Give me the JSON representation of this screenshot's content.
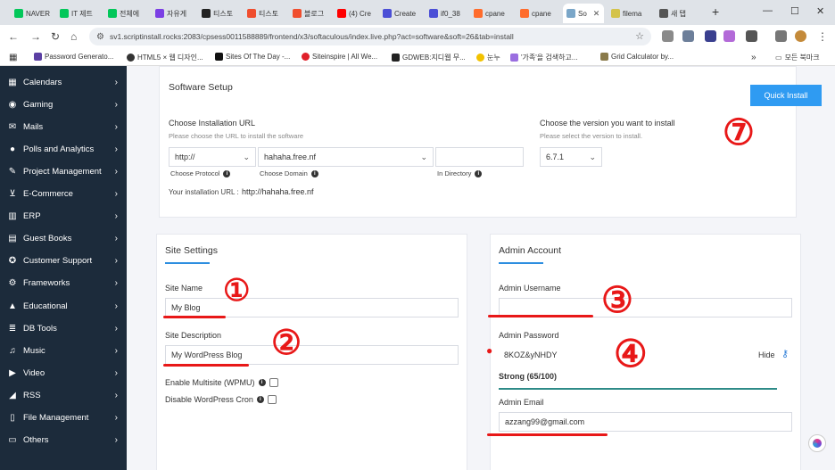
{
  "browser": {
    "tabs": [
      {
        "label": "NAVER",
        "color": "#03c75a"
      },
      {
        "label": "IT 제트",
        "color": "#03c75a"
      },
      {
        "label": "전체에",
        "color": "#03c75a"
      },
      {
        "label": "자유게",
        "color": "#7b3fe4"
      },
      {
        "label": "티스토",
        "color": "#222222"
      },
      {
        "label": "티스토",
        "color": "#f04e2e"
      },
      {
        "label": "블로그",
        "color": "#f04e2e"
      },
      {
        "label": "(4) Cre",
        "color": "#ff0000"
      },
      {
        "label": "Create",
        "color": "#4b4fd6"
      },
      {
        "label": "if0_38",
        "color": "#4b4fd6"
      },
      {
        "label": "cpane",
        "color": "#ff6c2c"
      },
      {
        "label": "cpane",
        "color": "#ff6c2c"
      },
      {
        "label": "So",
        "color": "#7aa6c8"
      },
      {
        "label": "filema",
        "color": "#d4c34a"
      },
      {
        "label": "새 탭",
        "color": "#555555"
      }
    ],
    "new_tab": "+",
    "window_controls": [
      "—",
      "☐",
      "✕"
    ],
    "url": "sv1.scriptinstall.rocks:2083/cpsess0011588889/frontend/x3/softaculous/index.live.php?act=software&soft=26&tab=install",
    "bookmarks": [
      "Password Generato...",
      "HTML5 × 웹 디자인...",
      "Sites Of The Day -...",
      "Siteinspire | All We...",
      "GDWEB:지디웹 무...",
      "눈누",
      "'가족'을 검색하고...",
      "Grid Calculator by..."
    ],
    "bookmarks_more": "»",
    "bookmarks_folder": "모든 북마크"
  },
  "sidebar": {
    "items": [
      {
        "label": "Calendars",
        "icon": "calendar-icon"
      },
      {
        "label": "Gaming",
        "icon": "gamepad-icon"
      },
      {
        "label": "Mails",
        "icon": "mail-icon"
      },
      {
        "label": "Polls and Analytics",
        "icon": "chat-icon"
      },
      {
        "label": "Project Management",
        "icon": "edit-icon"
      },
      {
        "label": "E-Commerce",
        "icon": "cart-icon"
      },
      {
        "label": "ERP",
        "icon": "chart-icon"
      },
      {
        "label": "Guest Books",
        "icon": "book-icon"
      },
      {
        "label": "Customer Support",
        "icon": "support-icon"
      },
      {
        "label": "Frameworks",
        "icon": "cogs-icon"
      },
      {
        "label": "Educational",
        "icon": "graduation-icon"
      },
      {
        "label": "DB Tools",
        "icon": "database-icon"
      },
      {
        "label": "Music",
        "icon": "music-icon"
      },
      {
        "label": "Video",
        "icon": "video-icon"
      },
      {
        "label": "RSS",
        "icon": "rss-icon"
      },
      {
        "label": "File Management",
        "icon": "file-icon"
      },
      {
        "label": "Others",
        "icon": "folder-icon"
      }
    ]
  },
  "software_setup": {
    "title": "Software Setup",
    "quick_install": "Quick Install",
    "url_label": "Choose Installation URL",
    "url_sub": "Please choose the URL to install the software",
    "protocol": "http://",
    "domain": "hahaha.free.nf",
    "directory": "",
    "protocol_hint": "Choose Protocol",
    "domain_hint": "Choose Domain",
    "directory_hint": "In Directory",
    "install_url_label": "Your installation URL :",
    "install_url": "http://hahaha.free.nf",
    "version_label": "Choose the version you want to install",
    "version_sub": "Please select the version to install.",
    "version": "6.7.1"
  },
  "site_settings": {
    "title": "Site Settings",
    "name_label": "Site Name",
    "name_value": "My Blog",
    "desc_label": "Site Description",
    "desc_value": "My WordPress Blog",
    "multisite_label": "Enable Multisite (WPMU)",
    "cron_label": "Disable WordPress Cron"
  },
  "admin_account": {
    "title": "Admin Account",
    "username_label": "Admin Username",
    "username_value": "",
    "password_label": "Admin Password",
    "password_value": "8KOZ&yNHDY",
    "hide_label": "Hide",
    "strength": "Strong (65/100)",
    "email_label": "Admin Email",
    "email_value": "azzang99@gmail.com"
  },
  "annotations": {
    "mark_1": "①",
    "mark_2": "②",
    "mark_3": "③",
    "mark_4": "④",
    "mark_5": "⑦"
  },
  "colors": {
    "sidebar_bg": "#1c2b3b",
    "accent": "#2f9bf2",
    "annotation": "#e81818",
    "strength_bar": "#2e8b88"
  }
}
